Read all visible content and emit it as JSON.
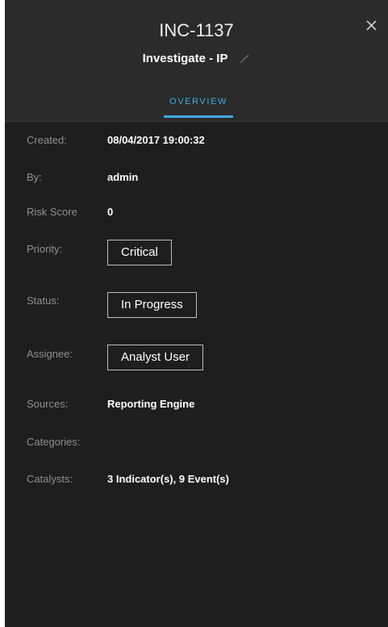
{
  "header": {
    "incident_id": "INC-1137",
    "title": "Investigate - IP",
    "close_glyph": "×",
    "edit_icon": "pencil-icon"
  },
  "tabs": [
    {
      "label": "OVERVIEW",
      "active": true
    }
  ],
  "accent_color": "#3fa9e5",
  "fields": {
    "created": {
      "label": "Created:",
      "value": "08/04/2017 19:00:32"
    },
    "by": {
      "label": "By:",
      "value": "admin"
    },
    "risk_score": {
      "label": "Risk Score",
      "value": "0"
    },
    "priority": {
      "label": "Priority:",
      "value": "Critical"
    },
    "status": {
      "label": "Status:",
      "value": "In Progress"
    },
    "assignee": {
      "label": "Assignee:",
      "value": "Analyst User"
    },
    "sources": {
      "label": "Sources:",
      "value": "Reporting Engine"
    },
    "categories": {
      "label": "Categories:",
      "value": ""
    },
    "catalysts": {
      "label": "Catalysts:",
      "value": "3 Indicator(s), 9 Event(s)"
    }
  }
}
